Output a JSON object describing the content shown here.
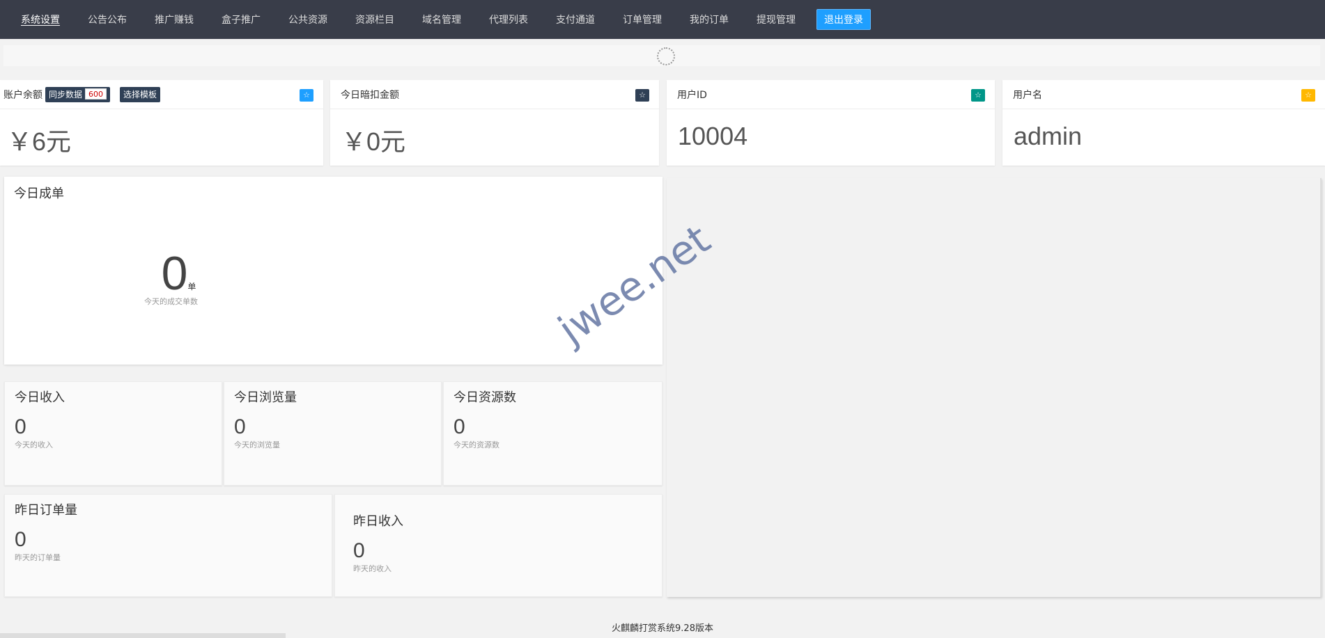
{
  "nav": {
    "items": [
      "系统设置",
      "公告公布",
      "推广赚钱",
      "盒子推广",
      "公共资源",
      "资源栏目",
      "域名管理",
      "代理列表",
      "支付通道",
      "订单管理",
      "我的订单",
      "提现管理"
    ],
    "logout": "退出登录"
  },
  "cards": {
    "balance": {
      "label": "账户余额",
      "sync_label": "同步数据",
      "sync_count": "600",
      "template_label": "选择模板",
      "value": "￥6元",
      "badge_color": "#1e9fff"
    },
    "deduct": {
      "label": "今日暗扣金额",
      "value": "￥0元",
      "badge_color": "#2f4056"
    },
    "user_id": {
      "label": "用户ID",
      "value": "10004",
      "badge_color": "#009688"
    },
    "username": {
      "label": "用户名",
      "value": "admin",
      "badge_color": "#ffb800"
    }
  },
  "star_icon": "☆",
  "today_orders": {
    "title": "今日成单",
    "value": "0",
    "unit": "单",
    "desc": "今天的成交单数"
  },
  "today_income": {
    "title": "今日收入",
    "value": "0",
    "desc": "今天的收入"
  },
  "today_views": {
    "title": "今日浏览量",
    "value": "0",
    "desc": "今天的浏览量"
  },
  "today_resources": {
    "title": "今日资源数",
    "value": "0",
    "desc": "今天的资源数"
  },
  "yesterday_orders": {
    "title": "昨日订单量",
    "value": "0",
    "desc": "昨天的订单量"
  },
  "yesterday_income": {
    "title": "昨日收入",
    "value": "0",
    "desc": "昨天的收入"
  },
  "watermark": "jwee.net",
  "footer": "火麒麟打赏系统9.28版本"
}
